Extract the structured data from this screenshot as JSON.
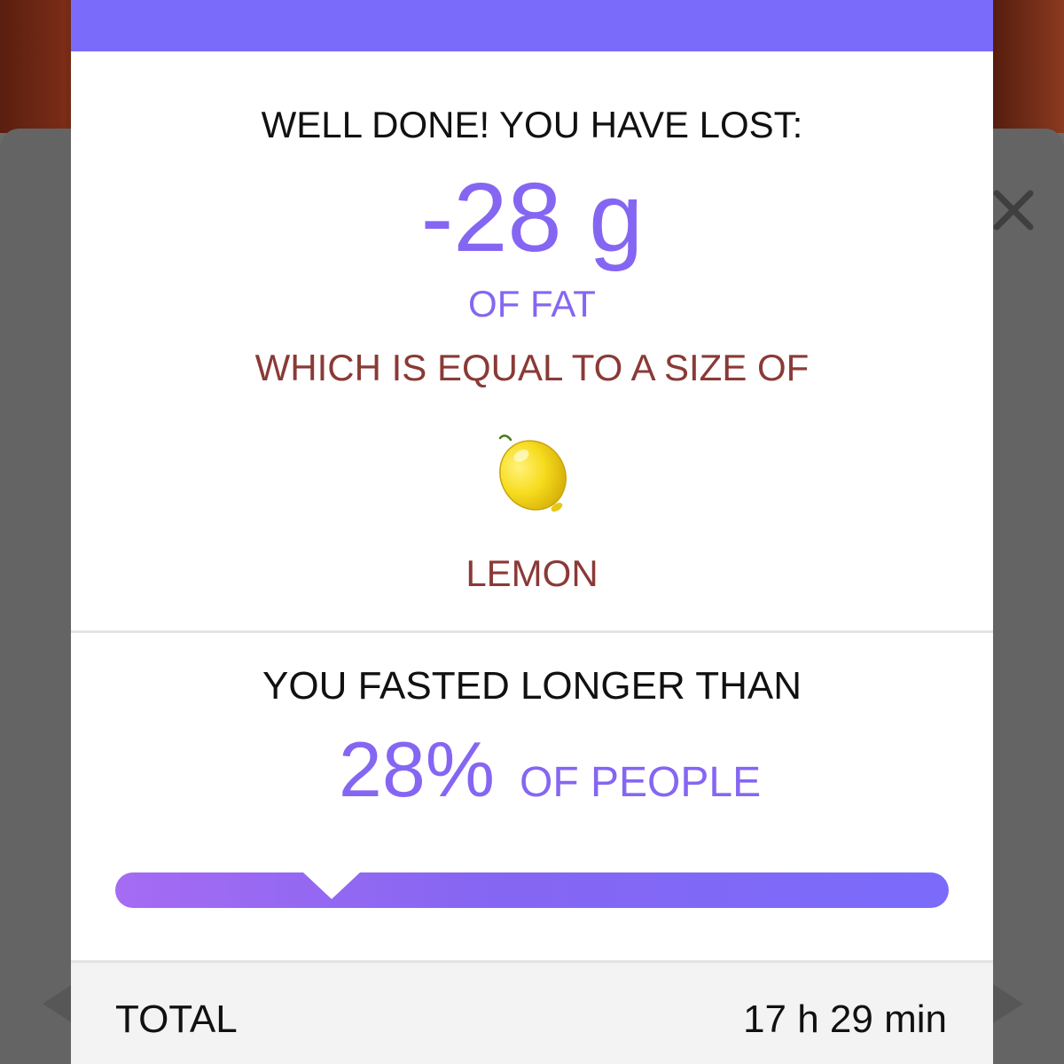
{
  "colors": {
    "accent": "#8566f2",
    "header": "#7b6bfb",
    "secondary_text": "#8a3a36",
    "overlay": "#646464"
  },
  "result": {
    "heading": "WELL DONE! YOU HAVE LOST:",
    "loss_value": "-28 g",
    "loss_unit": "OF FAT",
    "equal_text": "WHICH IS EQUAL TO A SIZE OF",
    "fruit_icon": "lemon-icon",
    "fruit_name": "LEMON"
  },
  "comparison": {
    "heading": "YOU FASTED LONGER THAN",
    "percent_value": "28%",
    "percent_suffix": "OF PEOPLE",
    "percentile": 0.26
  },
  "footer": {
    "label": "TOTAL",
    "value": "17 h 29 min"
  },
  "background": {
    "close_icon": "close-icon",
    "prev_icon": "chevron-left-icon",
    "next_icon": "chevron-right-icon"
  }
}
